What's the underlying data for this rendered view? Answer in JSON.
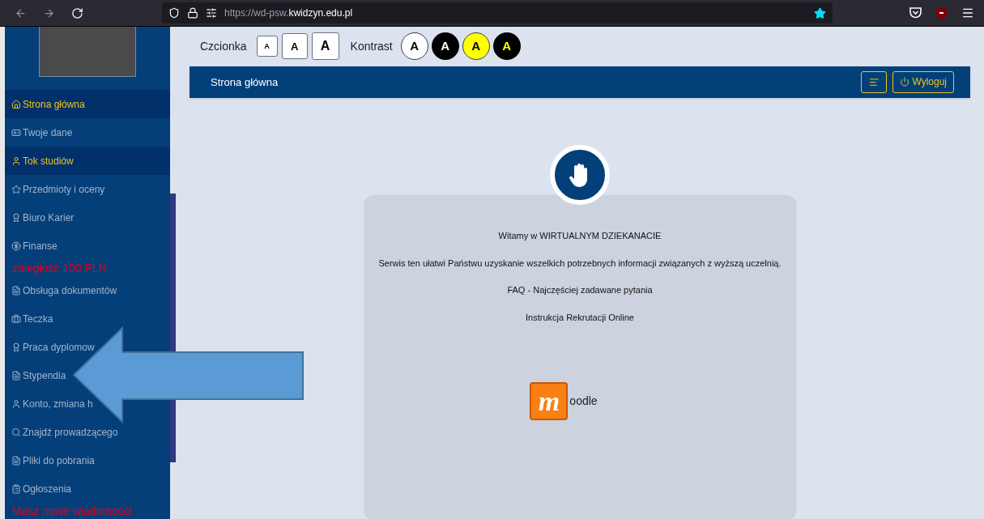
{
  "browser": {
    "url_prefix": "https://wd-psw.",
    "url_domain": "kwidzyn.edu.pl",
    "bookmarked": true
  },
  "accessibility": {
    "font_label": "Czcionka",
    "font_buttons": [
      {
        "label": "A"
      },
      {
        "label": "A"
      },
      {
        "label": "A"
      }
    ],
    "contrast_label": "Kontrast",
    "contrast_buttons": [
      {
        "label": "A"
      },
      {
        "label": "A"
      },
      {
        "label": "A"
      },
      {
        "label": "A"
      }
    ]
  },
  "sidebar": {
    "items": [
      {
        "kind": "link",
        "label": "Strona główna",
        "selected": true
      },
      {
        "kind": "link",
        "label": "Twoje dane",
        "selected": false
      },
      {
        "kind": "link",
        "label": "Tok studiów",
        "selected": true
      },
      {
        "kind": "link",
        "label": "Przedmioty i oceny",
        "selected": false
      },
      {
        "kind": "link",
        "label": "Biuro Karier",
        "selected": false
      },
      {
        "kind": "link",
        "label": "Finanse",
        "selected": false
      },
      {
        "kind": "notice",
        "label": "zaległość 100 PLN"
      },
      {
        "kind": "link",
        "label": "Obsługa dokumentów",
        "selected": false
      },
      {
        "kind": "link",
        "label": "Teczka",
        "selected": false
      },
      {
        "kind": "link",
        "label": "Praca dyplomow",
        "selected": false
      },
      {
        "kind": "link",
        "label": "Stypendia",
        "selected": false
      },
      {
        "kind": "link",
        "label": "Konto, zmiana h",
        "selected": false
      },
      {
        "kind": "link",
        "label": "Znajdź prowadzącego",
        "selected": false
      },
      {
        "kind": "link",
        "label": "Pliki do pobrania",
        "selected": false
      },
      {
        "kind": "link",
        "label": "Ogłoszenia",
        "selected": false
      },
      {
        "kind": "notice",
        "label": "Masz nowe wiadomości"
      }
    ]
  },
  "header": {
    "title": "Strona główna",
    "logout": "Wyloguj"
  },
  "welcome": {
    "lines": [
      "Witamy w WIRTUALNYM DZIEKANACIE",
      "Serwis ten ułatwi Państwu uzyskanie wszelkich potrzebnych informacji związanych z wyższą uczelnią.",
      "FAQ - Najczęściej zadawane pytania",
      "Instrukcja Rekrutacji Online"
    ],
    "moodle": {
      "letter": "m",
      "rest": "oodle"
    }
  }
}
